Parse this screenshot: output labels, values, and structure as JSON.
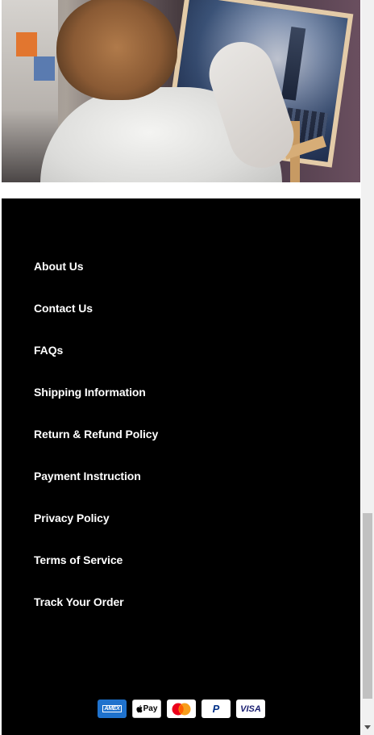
{
  "hero": {
    "image_icon": "painting-artist-photo"
  },
  "footer": {
    "links": [
      {
        "label": "About Us"
      },
      {
        "label": "Contact Us"
      },
      {
        "label": "FAQs"
      },
      {
        "label": "Shipping Information"
      },
      {
        "label": "Return & Refund Policy"
      },
      {
        "label": "Payment Instruction"
      },
      {
        "label": "Privacy Policy"
      },
      {
        "label": "Terms of Service"
      },
      {
        "label": "Track Your Order"
      }
    ],
    "payments": [
      {
        "name": "amex-icon",
        "label": "AMEX"
      },
      {
        "name": "apple-pay-icon",
        "label": "Pay"
      },
      {
        "name": "mastercard-icon",
        "label": ""
      },
      {
        "name": "paypal-icon",
        "label": "P"
      },
      {
        "name": "visa-icon",
        "label": "VISA"
      }
    ]
  },
  "colors": {
    "footer_bg": "#000000",
    "link_text": "#ffffff",
    "amex_blue": "#1f72cd",
    "visa_blue": "#1a1f71",
    "mastercard_red": "#eb001b",
    "mastercard_orange": "#f79e1b"
  }
}
